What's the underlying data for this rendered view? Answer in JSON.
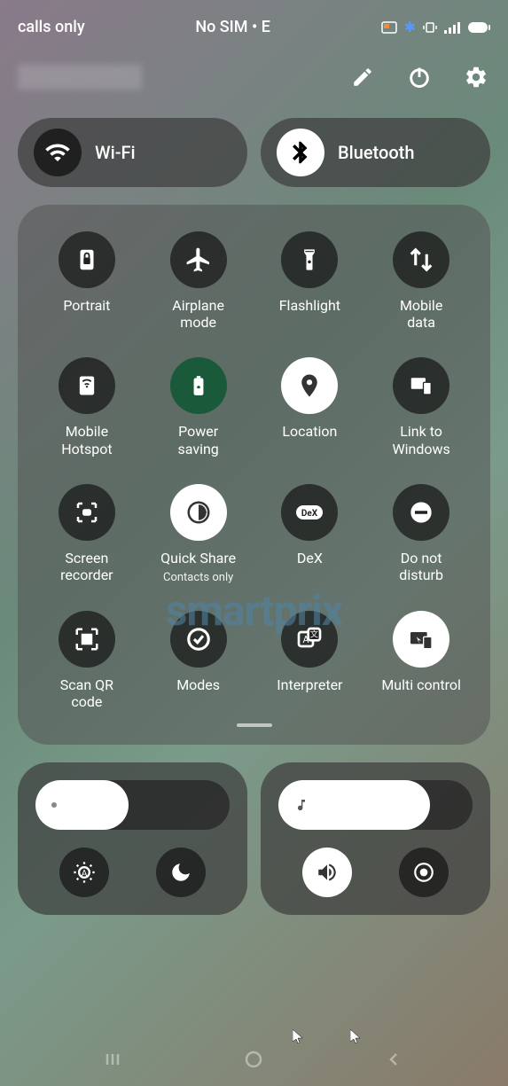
{
  "status": {
    "left": "calls only",
    "center": "No SIM • E",
    "cast": "cast",
    "bluetooth": "bt",
    "vibrate": "vib",
    "signal": "sig",
    "battery": "batt"
  },
  "header": {
    "edit": "Edit",
    "power": "Power",
    "settings": "Settings"
  },
  "pills": {
    "wifi": {
      "label": "Wi-Fi",
      "active": false
    },
    "bluetooth": {
      "label": "Bluetooth",
      "active": true
    }
  },
  "tiles": [
    {
      "id": "portrait",
      "label": "Portrait",
      "icon": "lock-rotation"
    },
    {
      "id": "airplane",
      "label": "Airplane\nmode",
      "icon": "airplane"
    },
    {
      "id": "flashlight",
      "label": "Flashlight",
      "icon": "flashlight"
    },
    {
      "id": "mobiledata",
      "label": "Mobile\ndata",
      "icon": "updown"
    },
    {
      "id": "hotspot",
      "label": "Mobile\nHotspot",
      "icon": "hotspot"
    },
    {
      "id": "powersaving",
      "label": "Power\nsaving",
      "icon": "battery-leaf",
      "green": true
    },
    {
      "id": "location",
      "label": "Location",
      "icon": "location",
      "active": true
    },
    {
      "id": "linkwindows",
      "label": "Link to\nWindows",
      "icon": "devices"
    },
    {
      "id": "screenrecorder",
      "label": "Screen\nrecorder",
      "icon": "screenrecord"
    },
    {
      "id": "quickshare",
      "label": "Quick Share",
      "sublabel": "Contacts only",
      "icon": "quickshare",
      "active": true
    },
    {
      "id": "dex",
      "label": "DeX",
      "icon": "dex"
    },
    {
      "id": "dnd",
      "label": "Do not\ndisturb",
      "icon": "minus"
    },
    {
      "id": "qrcode",
      "label": "Scan QR\ncode",
      "icon": "qrcode"
    },
    {
      "id": "modes",
      "label": "Modes",
      "icon": "modes"
    },
    {
      "id": "interpreter",
      "label": "Interpreter",
      "icon": "interpreter"
    },
    {
      "id": "multicontrol",
      "label": "Multi control",
      "icon": "multicontrol",
      "active": true
    }
  ],
  "sliders": {
    "brightness": {
      "value": 45
    },
    "volume": {
      "value": 75
    }
  },
  "watermark": "smartprix"
}
